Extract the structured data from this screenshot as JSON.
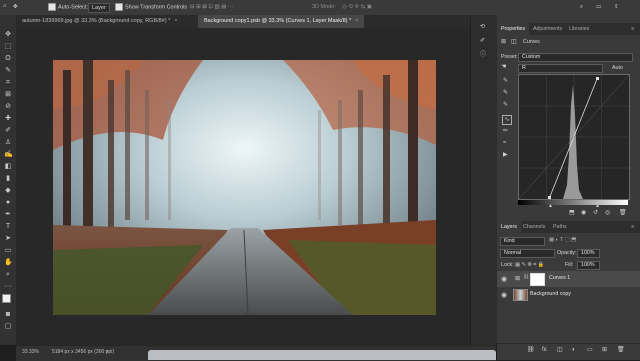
{
  "options_bar": {
    "auto_select_label": "Auto-Select:",
    "auto_select_value": "Layer",
    "show_transform_label": "Show Transform Controls",
    "mode_label": "3D Mode:"
  },
  "tabs": [
    {
      "label": "autumn-1839969.jpg @ 33.3% (Background copy, RGB/8#) *",
      "close": "×"
    },
    {
      "label": "Background copy1.psb @ 33.3% (Curves 1, Layer Mask/8) *",
      "close": "×"
    }
  ],
  "status": {
    "zoom": "33.33%",
    "doc_info": "5184 px x 3456 px (300 ppi)"
  },
  "properties_panel": {
    "tabs": [
      "Properties",
      "Adjustments",
      "Libraries"
    ],
    "adjustment_name": "Curves",
    "preset_label": "Preset:",
    "preset_value": "Custom",
    "channel_value": "R",
    "auto_button": "Auto"
  },
  "layers_panel": {
    "tabs": [
      "Layers",
      "Channels",
      "Paths"
    ],
    "filter_value": "Kind",
    "blend_mode": "Normal",
    "opacity_label": "Opacity:",
    "opacity_value": "100%",
    "lock_label": "Lock:",
    "fill_label": "Fill:",
    "fill_value": "100%",
    "layers": [
      {
        "name": "Curves 1"
      },
      {
        "name": "Background copy"
      }
    ]
  },
  "colors": {
    "ui_dark": "#323232",
    "panel": "#3a3a3a",
    "accent": "#1473e6"
  }
}
